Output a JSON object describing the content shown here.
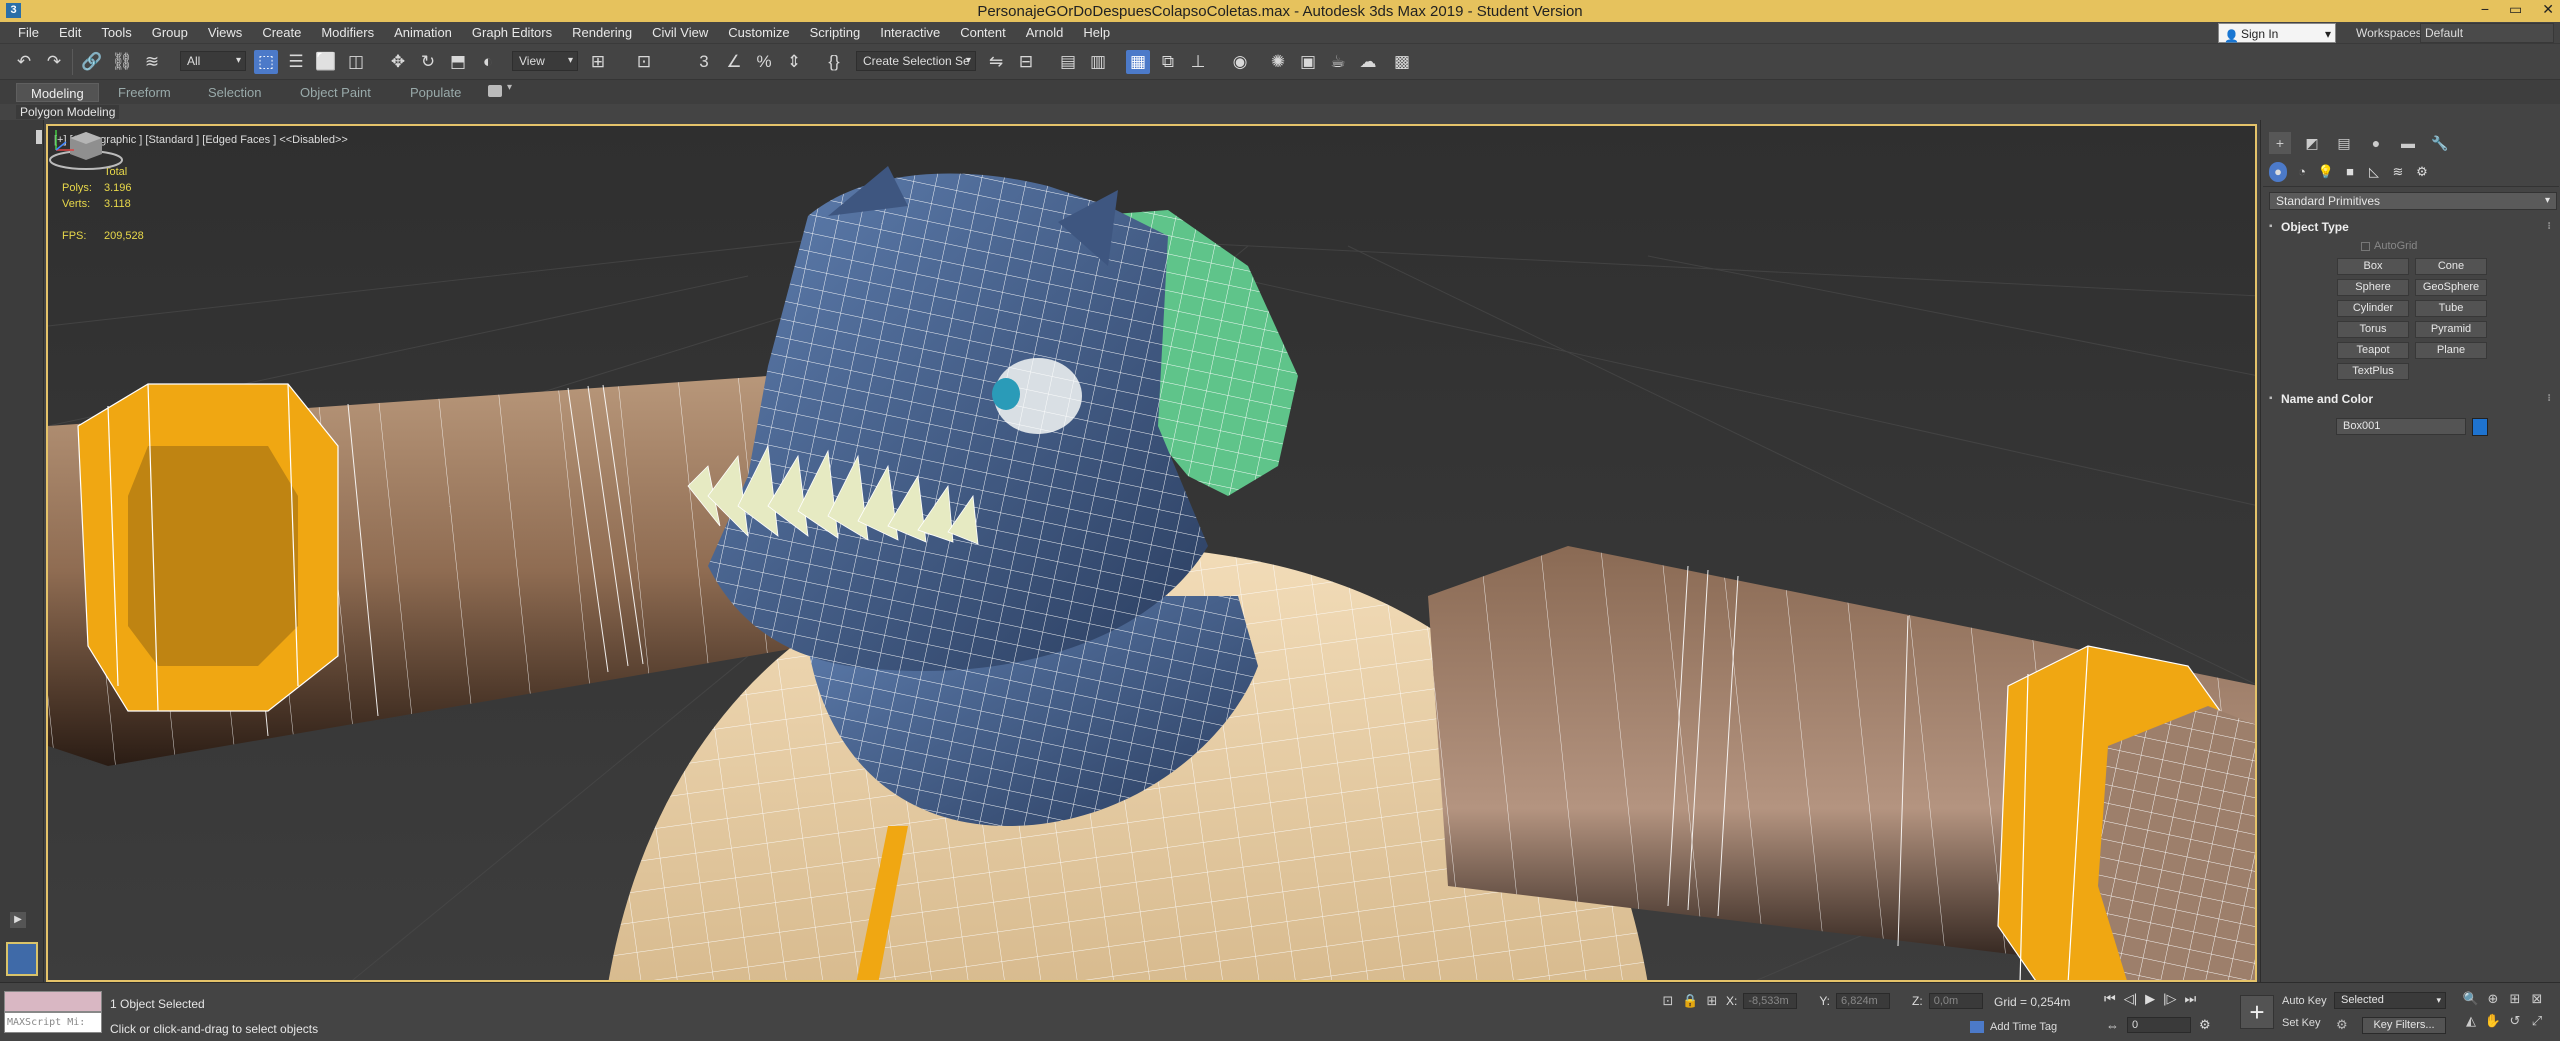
{
  "window": {
    "title": "PersonajeGOrDoDespuesColapsoColetas.max - Autodesk 3ds Max 2019 - Student Version",
    "app_icon_label": "3",
    "minimize": "−",
    "maximize": "▭",
    "close": "✕"
  },
  "menu": {
    "items": [
      "File",
      "Edit",
      "Tools",
      "Group",
      "Views",
      "Create",
      "Modifiers",
      "Animation",
      "Graph Editors",
      "Rendering",
      "Civil View",
      "Customize",
      "Scripting",
      "Interactive",
      "Content",
      "Arnold",
      "Help"
    ],
    "sign_in": "Sign In",
    "workspaces_label": "Workspaces:",
    "workspaces_value": "Default"
  },
  "toolbar": {
    "selection_filter": "All",
    "reference_coord": "View",
    "selection_set_placeholder": "Create Selection Se"
  },
  "ribbon": {
    "tabs": [
      "Modeling",
      "Freeform",
      "Selection",
      "Object Paint",
      "Populate"
    ],
    "active_tab": "Modeling",
    "panel_label": "Polygon Modeling"
  },
  "viewport": {
    "label": "[+] [Orthographic ] [Standard ] [Edged Faces ]  <<Disabled>>",
    "stats": {
      "header": "Total",
      "polys_label": "Polys:",
      "polys_value": "3.196",
      "verts_label": "Verts:",
      "verts_value": "3.118",
      "fps_label": "FPS:",
      "fps_value": "209,528"
    }
  },
  "command_panel": {
    "primitive_type": "Standard Primitives",
    "object_type_title": "Object Type",
    "autogrid_label": "AutoGrid",
    "primitives": [
      "Box",
      "Cone",
      "Sphere",
      "GeoSphere",
      "Cylinder",
      "Tube",
      "Torus",
      "Pyramid",
      "Teapot",
      "Plane",
      "TextPlus"
    ],
    "name_color_title": "Name and Color",
    "object_name": "Box001",
    "object_color": "#1e73d0"
  },
  "status": {
    "maxscript_placeholder": "MAXScript Mi:",
    "objects_selected": "1 Object Selected",
    "prompt": "Click or click-and-drag to select objects",
    "x_label": "X:",
    "x_value": "-8,533m",
    "y_label": "Y:",
    "y_value": "6,824m",
    "z_label": "Z:",
    "z_value": "0,0m",
    "grid": "Grid = 0,254m",
    "add_time_tag": "Add Time Tag",
    "frame": "0",
    "auto_key": "Auto Key",
    "set_key": "Set Key",
    "selected_dropdown": "Selected",
    "key_filters": "Key Filters..."
  },
  "colors": {
    "title_bar": "#e6c25d",
    "accent": "#4c7ac9",
    "viewport_border": "#e5c36a",
    "stats_text": "#e8d84a"
  }
}
